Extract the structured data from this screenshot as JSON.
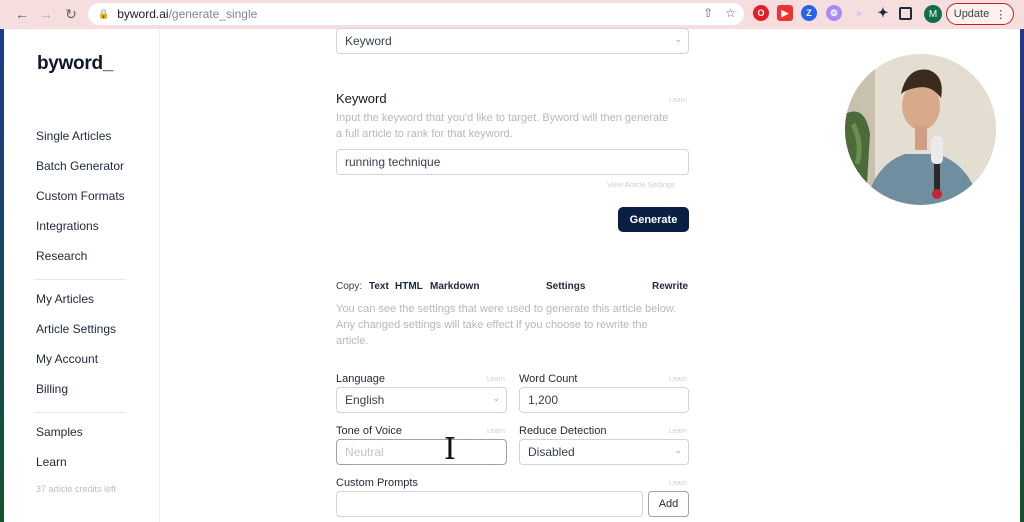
{
  "browser": {
    "url_host": "byword.ai",
    "url_path": "/generate_single",
    "profile_initial": "M",
    "update_label": "Update",
    "back_icon": "back-arrow-icon",
    "forward_icon": "forward-arrow-icon",
    "reload_icon": "reload-icon"
  },
  "sidebar": {
    "logo": "byword_",
    "group1": [
      "Single Articles",
      "Batch Generator",
      "Custom Formats",
      "Integrations",
      "Research"
    ],
    "group2": [
      "My Articles",
      "Article Settings",
      "My Account",
      "Billing"
    ],
    "group3": [
      "Samples",
      "Learn"
    ],
    "credits": "37 article credits left"
  },
  "form": {
    "mode_select": "Keyword",
    "keyword_heading": "Keyword",
    "keyword_learn": "Learn",
    "keyword_help": "Input the keyword that you'd like to target. Byword will then generate a full article to rank for that keyword.",
    "keyword_value": "running technique",
    "view_settings": "View Article Settings",
    "generate_label": "Generate"
  },
  "article": {
    "copy_label": "Copy:",
    "copy_text": "Text",
    "copy_html": "HTML",
    "copy_markdown": "Markdown",
    "settings": "Settings",
    "rewrite": "Rewrite",
    "help": "You can see the settings that were used to generate this article below. Any changed settings will take effect if you choose to rewrite the article."
  },
  "settings": {
    "language_label": "Language",
    "language_value": "English",
    "word_count_label": "Word Count",
    "word_count_value": "1,200",
    "tone_label": "Tone of Voice",
    "tone_placeholder": "Neutral",
    "reduce_label": "Reduce Detection",
    "reduce_value": "Disabled",
    "custom_prompts_label": "Custom Prompts",
    "add_label": "Add",
    "learn": "Learn"
  }
}
